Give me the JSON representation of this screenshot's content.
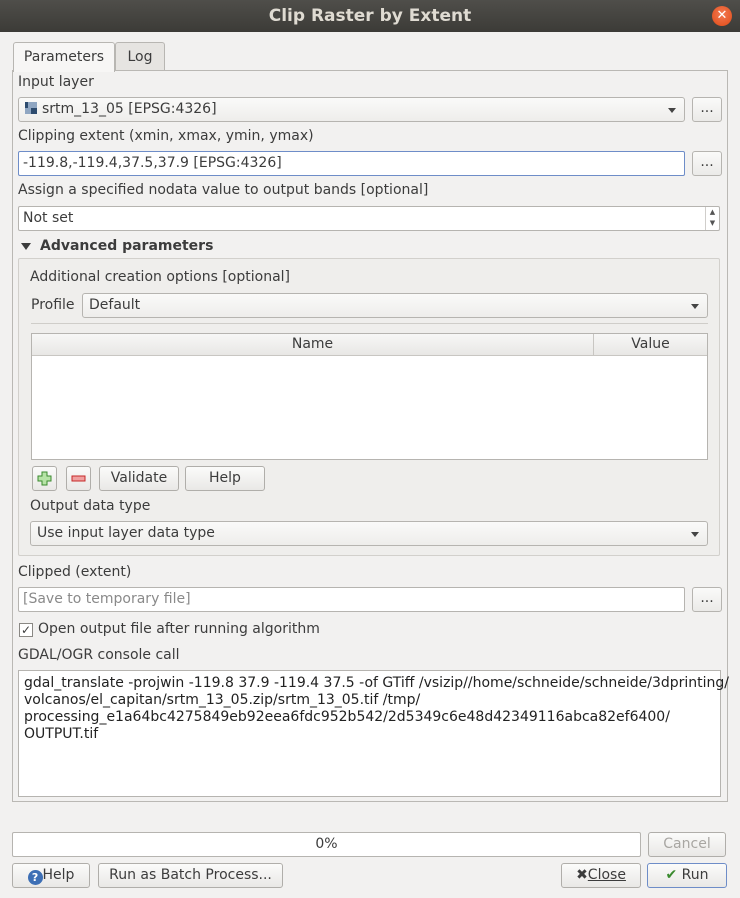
{
  "window": {
    "title": "Clip Raster by Extent"
  },
  "tabs": [
    {
      "label": "Parameters"
    },
    {
      "label": "Log"
    }
  ],
  "input_layer": {
    "label": "Input layer",
    "value": "srtm_13_05 [EPSG:4326]"
  },
  "clipping_extent": {
    "label": "Clipping extent (xmin, xmax, ymin, ymax)",
    "value": "-119.8,-119.4,37.5,37.9 [EPSG:4326]"
  },
  "nodata": {
    "label": "Assign a specified nodata value to output bands [optional]",
    "value": "Not set"
  },
  "advanced": {
    "label": "Advanced parameters",
    "creation_options_label": "Additional creation options [optional]",
    "profile_label": "Profile",
    "profile_value": "Default",
    "table_headers": [
      "Name",
      "Value"
    ],
    "validate_label": "Validate",
    "help_label": "Help",
    "output_type_label": "Output data type",
    "output_type_value": "Use input layer data type"
  },
  "clipped": {
    "label": "Clipped (extent)",
    "placeholder": "[Save to temporary file]"
  },
  "open_output": {
    "label": "Open output file after running algorithm",
    "checked": true
  },
  "console": {
    "label": "GDAL/OGR console call",
    "lines": [
      "gdal_translate -projwin -119.8 37.9 -119.4 37.5 -of GTiff /vsizip//home/schneide/schneide/3dprinting/",
      "volcanos/el_capitan/srtm_13_05.zip/srtm_13_05.tif /tmp/",
      "processing_e1a64bc4275849eb92eea6fdc952b542/2d5349c6e48d42349116abca82ef6400/",
      "OUTPUT.tif"
    ]
  },
  "progress": {
    "text": "0%",
    "value": 0
  },
  "buttons": {
    "ellipsis": "...",
    "cancel": "Cancel",
    "help": "Help",
    "batch": "Run as Batch Process...",
    "close": "Close",
    "run": "Run"
  },
  "colors": {
    "title_bg": "#3c3b37",
    "close_orange": "#df4a16",
    "run_check": "#3a8a2e"
  }
}
